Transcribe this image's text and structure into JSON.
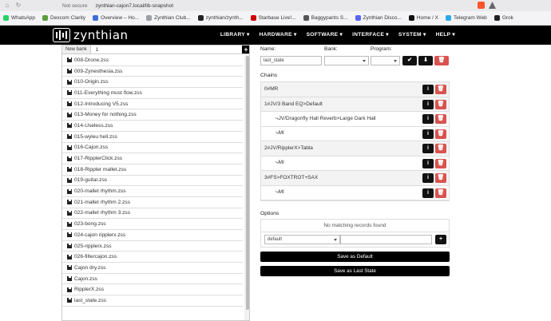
{
  "browser": {
    "security": "Not secure",
    "url": "zynthian-cajon7.local/lib-snapshot",
    "bookmarks": [
      "WhatsApp",
      "Dexcom Clarity",
      "Overview – Ho...",
      "Zynthian Club...",
      "zynthian/zynth...",
      "Starbase Live!...",
      "Baggypants S...",
      "Zynthian Disco...",
      "Home / X",
      "Telegram Web",
      "Grok"
    ],
    "bookmark_colors": [
      "#25d366",
      "#5a9e3a",
      "#3b6fd8",
      "#9aa0a6",
      "#222222",
      "#cc0000",
      "#555555",
      "#5865f2",
      "#111111",
      "#2aabee",
      "#222222"
    ]
  },
  "nav": {
    "brand": "zynthian",
    "menu": [
      "LIBRARY ▾",
      "HARDWARE ▾",
      "SOFTWARE ▾",
      "INTERFACE ▾",
      "SYSTEM ▾",
      "HELP ▾"
    ]
  },
  "bank": {
    "tab_label": "New bank",
    "value": "1",
    "add": "+"
  },
  "files": [
    "008-Drone.zss",
    "009-Zynesthesia.zss",
    "010-Origin.zss",
    "011-Everything must flow.zss",
    "012-Introducing V5.zss",
    "013-Money for nothing.zss",
    "014-Useless.zss",
    "015-wyleu hell.zss",
    "016-Cajon.zss",
    "017-RipplerClick.zss",
    "018-Rippler mallet.zss",
    "019-guitar.zss",
    "020-mallet rhythm.zss",
    "021-mallet rhythm 2.zss",
    "022-mallet rhythm 3.zss",
    "023-bong.zss",
    "024-cajon ripplerx.zss",
    "025-ripplerx.zss",
    "026-filtercajon.zss",
    "Cajon dry.zss",
    "Cajon.zss",
    "RipplerX.zss",
    "last_state.zss"
  ],
  "form": {
    "name_label": "Name:",
    "name_value": "last_state",
    "bank_label": "Bank:",
    "program_label": "Program:"
  },
  "chains_title": "Chains",
  "chains": [
    {
      "label": "0#MR",
      "kind": "chain"
    },
    {
      "label": "1#JV/3 Band EQ>Default",
      "kind": "chain"
    },
    {
      "label": "⤷JV/Dragonfly Hall Reverb>Large Dark Hall",
      "kind": "sub"
    },
    {
      "label": "⤷MI",
      "kind": "sub"
    },
    {
      "label": "2#JV/RipplerX>Tabla",
      "kind": "chain"
    },
    {
      "label": "⤷MI",
      "kind": "sub"
    },
    {
      "label": "3#FS>FOXTROT+SAX",
      "kind": "chain"
    },
    {
      "label": "⤷MI",
      "kind": "sub"
    }
  ],
  "options": {
    "title": "Options",
    "empty": "No matching records found",
    "select_value": "default",
    "add": "+"
  },
  "buttons": {
    "save_default": "Save as Default",
    "save_last": "Save as Last State"
  },
  "icons": {
    "info": "i",
    "delete": "🗑",
    "ok": "✔",
    "download": "⬇"
  }
}
